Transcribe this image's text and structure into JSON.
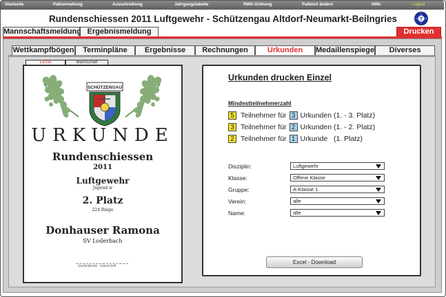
{
  "topnav": {
    "items": [
      "Startseite",
      "Paßverwaltung",
      "Ausschreibung",
      "Jahrgangstabelle",
      "RWK-Ordnung",
      "Paßwort ändern",
      "Hilfe"
    ],
    "last_item": "Logout"
  },
  "header": {
    "title": "Rundenschiessen 2011 Luftgewehr  -  Schützengau Altdorf-Neumarkt-Beilngries",
    "logo_icon": "gau-logo-icon"
  },
  "top_tabs": {
    "left": [
      "Mannschaftsmeldung",
      "Ergebnismeldung"
    ],
    "right": "Drucken"
  },
  "nav_tabs": {
    "items": [
      "Wettkampfbögen",
      "Terminpläne",
      "Ergebnisse",
      "Rechnungen",
      "Urkunden",
      "Medaillenspiegel",
      "Diverses"
    ],
    "active": "Urkunden"
  },
  "cert_tabs": {
    "einzel": "Einzel",
    "mannschaft": "Mannschaft"
  },
  "certificate": {
    "crest_label": "SCHÜTZENGAU",
    "heading": "URKUNDE",
    "event": "Rundenschiessen",
    "year": "2011",
    "discipline": "Luftgewehr",
    "class": "Jugend w",
    "place": "2. Platz",
    "score": "224 Ringe",
    "name": "Donhauser Ramona",
    "club": "SV Loderbach",
    "signature": "Gaufunktionär · Unterschrift"
  },
  "panel": {
    "title": "Urkunden drucken Einzel",
    "subtitle": "Mindestteilnehmerzahl",
    "rules": [
      {
        "participants": "5",
        "word1": "Teilnehmer für",
        "certs": "3",
        "word2": "Urkunden (1. - 3. Platz)"
      },
      {
        "participants": "3",
        "word1": "Teilnehmer für",
        "certs": "2",
        "word2": "Urkunden (1. - 2. Platz)"
      },
      {
        "participants": "2",
        "word1": "Teilnehmer für",
        "certs": "1",
        "word2": "Urkunde   (1. Platz)"
      }
    ],
    "fields": {
      "disziplin": {
        "label": "Disziplin:",
        "value": "Luftgewehr"
      },
      "klasse": {
        "label": "Klasse:",
        "value": "Offene Klasse"
      },
      "gruppe": {
        "label": "Gruppe:",
        "value": "A-Klasse 1"
      },
      "verein": {
        "label": "Verein:",
        "value": "alle"
      },
      "name": {
        "label": "Name:",
        "value": "alle"
      }
    },
    "download_button": "Excel - Download"
  },
  "colors": {
    "accent_red": "#e03030",
    "highlight_yellow": "#f5e626",
    "highlight_blue": "#a9d6ef",
    "leaf_green": "#7fa673",
    "nav_grey": "#6e6e6e"
  }
}
